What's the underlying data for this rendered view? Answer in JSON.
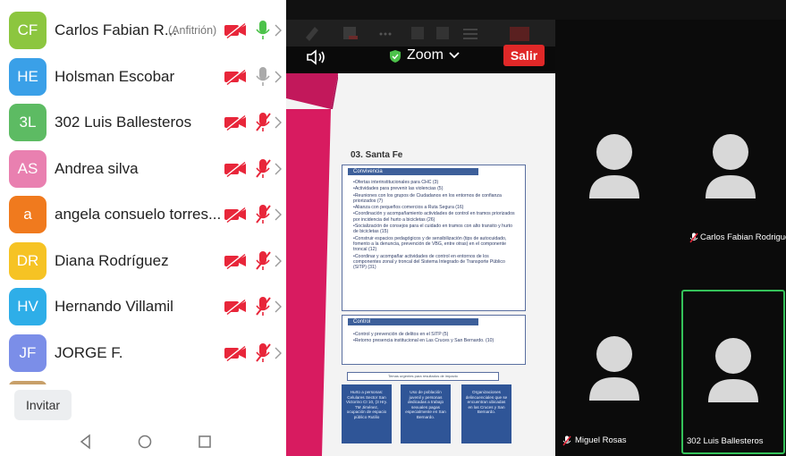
{
  "participants": [
    {
      "initials": "CF",
      "name": "Carlos Fabian R...",
      "host_label": "(Anfitrión)",
      "color": "#8cc63f",
      "mic": "on"
    },
    {
      "initials": "HE",
      "name": "Holsman Escobar",
      "host_label": "",
      "color": "#3aa0e8",
      "mic": "gray"
    },
    {
      "initials": "3L",
      "name": "302 Luis Ballesteros",
      "host_label": "",
      "color": "#5dbb63",
      "mic": "muted"
    },
    {
      "initials": "AS",
      "name": "Andrea silva",
      "host_label": "",
      "color": "#e980b0",
      "mic": "muted"
    },
    {
      "initials": "a",
      "name": "angela consuelo torres...",
      "host_label": "",
      "color": "#f07a1e",
      "mic": "muted"
    },
    {
      "initials": "DR",
      "name": "Diana Rodríguez",
      "host_label": "",
      "color": "#f6c324",
      "mic": "muted"
    },
    {
      "initials": "HV",
      "name": "Hernando Villamil",
      "host_label": "",
      "color": "#2eaee8",
      "mic": "muted"
    },
    {
      "initials": "JF",
      "name": "JORGE F.",
      "host_label": "",
      "color": "#7b8ee8",
      "mic": "muted"
    }
  ],
  "invite_label": "Invitar",
  "meeting": {
    "title": "Zoom",
    "leave_label": "Salir"
  },
  "slide": {
    "title": "03. Santa Fe",
    "section1_head": "Convivencia",
    "section1_items": [
      "•Ofertas interinstitucionales para CHC (3)",
      "•Actividades para prevenir las violencias (5)",
      "•Reuniones con los grupos de Ciudadanos en los entornos de confianza priorizados (7)",
      "•Alianza con pequeños comercios a Ruta Segura (16)",
      "•Coordinación y acompañamiento actividades de control en tramos priorizados por incidencia del hurto a bicicletas (26)",
      "•Socialización de consejos para el cuidado en tramos con alto transito y hurto de bicicletas (15)",
      "•Construir espacios pedagógicos y de sensibilización (tips de autocuidado, fomento a la denuncia, prevención de VBG, entre otras) en el componente troncal (12)",
      "•Coordinar y acompañar actividades de control en entornos de los componentes zonal y troncal del Sistema Integrado de Transporte Público (SITP) (31)"
    ],
    "section2_head": "Control",
    "section2_items": [
      "•Control y prevención de delitos en el SITP (5)",
      "•Retorno presencia institucional en Las Cruces y San Bernardo. (10)"
    ],
    "note": "Temas urgentes para resultados de impacto",
    "cards": [
      "Hurto a personas: Celulares Sector San Victorino CI 10, (3 Hry. TM Jiménez, ocupación de espacio público Rutilio",
      "Uso de población juvenil y personas dedicadas a trabajo sexuales pagas especialmente en San Bernardo.",
      "Organizaciones delincuenciales que se encuentran ubicadas en las Cruces y San Bernardo."
    ]
  },
  "video_tiles": [
    {
      "name": ""
    },
    {
      "name": "Carlos Fabian Rodrigue"
    },
    {
      "name": "Miguel Rosas"
    },
    {
      "name": "302 Luis Ballesteros"
    }
  ],
  "colors": {
    "video_off_red": "#e8263a",
    "mic_muted_red": "#e8263a",
    "mic_on_green": "#4cc24a",
    "active_speaker_border": "#35c25a",
    "slide_accent_pink": "#d81b60",
    "leave_button": "#e02828"
  }
}
